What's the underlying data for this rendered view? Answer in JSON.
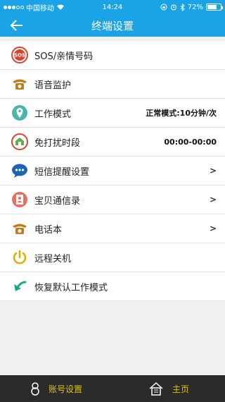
{
  "status_bar": {
    "carrier": "中国移动",
    "time": "14:24",
    "battery": "72%",
    "battery_level": 0.72
  },
  "header": {
    "title": "终端设置"
  },
  "settings": [
    {
      "label": "SOS/亲情号码",
      "value": "",
      "icon": "sos-icon"
    },
    {
      "label": "语音监护",
      "value": "",
      "icon": "phone-icon"
    },
    {
      "label": "工作模式",
      "value": "正常模式:10分钟/次",
      "icon": "location-pin-icon"
    },
    {
      "label": "免打扰时段",
      "value": "00:00-00:00",
      "icon": "do-not-disturb-icon"
    },
    {
      "label": "短信提醒设置",
      "value": ">",
      "icon": "chat-bubble-icon"
    },
    {
      "label": "宝贝通信录",
      "value": ">",
      "icon": "contacts-icon"
    },
    {
      "label": "电话本",
      "value": ">",
      "icon": "phone-book-icon"
    },
    {
      "label": "远程关机",
      "value": "",
      "icon": "power-icon"
    },
    {
      "label": "恢复默认工作模式",
      "value": "",
      "icon": "restore-icon"
    }
  ],
  "bottom_bar": {
    "account_label": "账号设置",
    "home_label": "主页"
  },
  "colors": {
    "primary": "#1ba3e8",
    "bottom_bar": "#2b2b2b",
    "bottom_text": "#e0c000"
  }
}
